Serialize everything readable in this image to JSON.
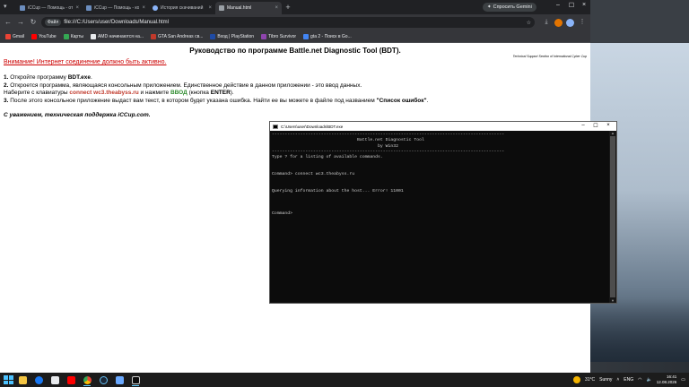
{
  "browser": {
    "tabs": [
      {
        "label": "iCCup — Помощь - ответ ой...",
        "active": false
      },
      {
        "label": "iCCup — Помощь - кострук и...",
        "active": false
      },
      {
        "label": "История скачиваний",
        "active": false
      },
      {
        "label": "Manual.html",
        "active": true
      }
    ],
    "new_tab": "+",
    "gemini_label": "Спросить Gemini",
    "chip_label": "Файл",
    "url": "file:///C:/Users/user/Downloads/Manual.html",
    "bookmarks": [
      {
        "label": "Gmail",
        "color": "#ea4335"
      },
      {
        "label": "YouTube",
        "color": "#ff0000"
      },
      {
        "label": "Карты",
        "color": "#34a853"
      },
      {
        "label": "AMD начинаются на...",
        "color": "#e8eaed"
      },
      {
        "label": "GTA San Andreas св...",
        "color": "#c0392b"
      },
      {
        "label": "Вход | PlayStation",
        "color": "#1f4ba5"
      },
      {
        "label": "Tibro Survivor",
        "color": "#8e44ad"
      },
      {
        "label": "gta 2 - Поиск в Go...",
        "color": "#4285f4"
      }
    ]
  },
  "page": {
    "title": "Руководство по программе Battle.net Diagnostic Tool (BDT).",
    "subtitle": "Technical Support Section of International Cyber Cup",
    "warning": "Внимание! Интернет соединение должно быть активно.",
    "step1_num": "1.",
    "step1_text": " Откройте программу ",
    "step1_bold": "BDT.exe",
    "step1_end": ".",
    "step2_num": "2.",
    "step2_text": " Откроется программа, являющаяся консольным приложением. Единственное действие в данном приложении - это ввод данных.",
    "step2b_text": "Наберите с клавиатуры ",
    "step2b_cmd": "connect wc3.theabyss.ru",
    "step2b_mid": " и нажмите ",
    "step2b_key": "ВВОД",
    "step2b_paren": " (кнопка ",
    "step2b_enter": "ENTER",
    "step2b_end": ").",
    "step3_num": "3.",
    "step3_text": " После этого консольное приложение выдаст вам текст, в котором будет указана ошибка. Найти ее вы можете в файле под названием ",
    "step3_bold": "\"Список ошибок\"",
    "step3_end": ".",
    "signature": "С уважением, техническая поддержка iCCup.com."
  },
  "console": {
    "title": "C:\\Users\\user\\Downloads\\BDT.exe",
    "text": "------------------------------------------------------------------------------------------\n                                 Battle.net Diagnostic Tool\n                                         by Win32\n------------------------------------------------------------------------------------------\nType ? for a listing of available commands.\n\n\nCommand> connect wc3.theabyss.ru\n\n\nQuerying information about the host... Error! 11001\n\n\n\nCommand>"
  },
  "taskbar": {
    "apps": [
      {
        "name": "file-explorer",
        "color": "#f4c542"
      },
      {
        "name": "facebook",
        "color": "#1877f2"
      },
      {
        "name": "mail",
        "color": "#e8eaed"
      },
      {
        "name": "youtube",
        "color": "#ff0000"
      },
      {
        "name": "chrome",
        "color": "#34a853"
      },
      {
        "name": "steam",
        "color": "#1b2838"
      },
      {
        "name": "vpn",
        "color": "#6aa9ff"
      },
      {
        "name": "console",
        "color": "#cccccc"
      }
    ],
    "temperature": "31°C",
    "weather": "Sunny",
    "lang": "ENG",
    "time": "16:41",
    "date": "12.08.2026"
  }
}
